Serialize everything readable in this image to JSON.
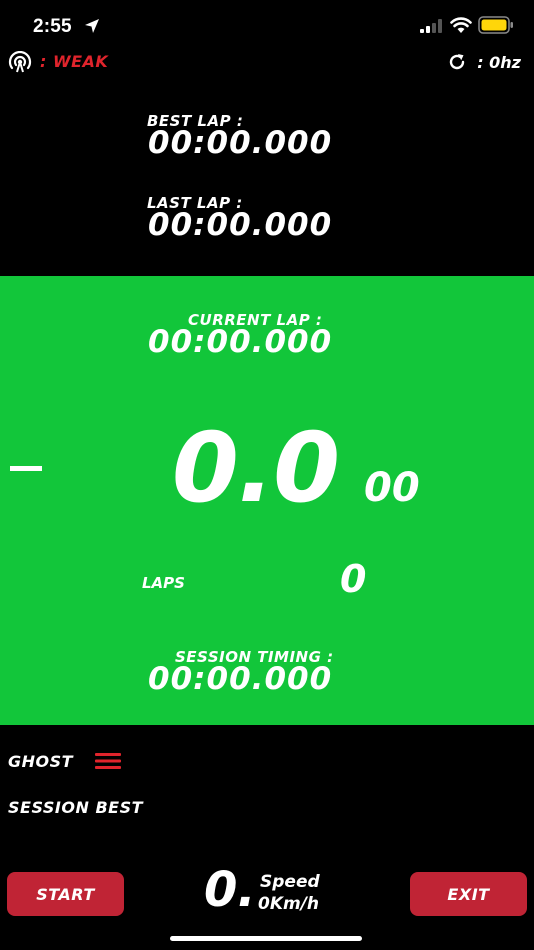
{
  "status_bar": {
    "time": "2:55"
  },
  "header": {
    "gps_status": ": WEAK",
    "refresh_rate": ": 0hz"
  },
  "timers": {
    "best_lap_label": "BEST LAP :",
    "best_lap_value": "00:00.000",
    "last_lap_label": "LAST LAP :",
    "last_lap_value": "00:00.000"
  },
  "panel": {
    "current_lap_label": "CURRENT LAP :",
    "current_lap_value": "00:00.000",
    "delta_sign": "-",
    "delta_main": "0.0",
    "delta_fraction": "00",
    "laps_label": "LAPS",
    "laps_value": "0",
    "session_timing_label": "SESSION TIMING :",
    "session_timing_value": "00:00.000"
  },
  "ghost": {
    "label": "GHOST",
    "mode": "SESSION BEST"
  },
  "footer": {
    "start_label": "START",
    "exit_label": "EXIT",
    "speed_int": "0.",
    "speed_label": "Speed",
    "speed_value": "0Km/h"
  },
  "colors": {
    "background": "#000000",
    "panel_green": "#12c63a",
    "accent_red": "#e0242c",
    "button_red": "#c02435"
  },
  "icons": [
    "location-arrow-icon",
    "cellular-signal-icon",
    "wifi-icon",
    "battery-icon",
    "gps-signal-icon",
    "refresh-icon",
    "menu-icon"
  ]
}
